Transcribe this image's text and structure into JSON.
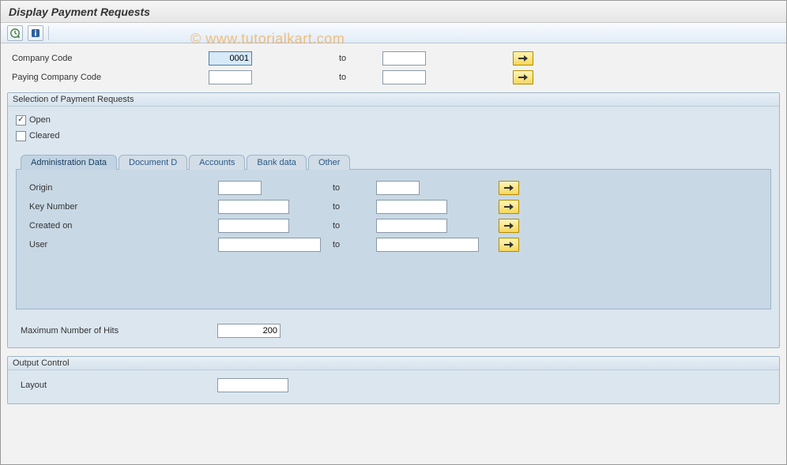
{
  "header": {
    "title": "Display Payment Requests"
  },
  "watermark": "© www.tutorialkart.com",
  "top_fields": {
    "company_code": {
      "label": "Company Code",
      "value": "0001",
      "to": "to",
      "to_value": ""
    },
    "paying_company_code": {
      "label": "Paying Company Code",
      "value": "",
      "to": "to",
      "to_value": ""
    }
  },
  "selection_group": {
    "title": "Selection of Payment Requests",
    "open": {
      "label": "Open",
      "checked": true
    },
    "cleared": {
      "label": "Cleared",
      "checked": false
    },
    "tabs": [
      "Administration Data",
      "Document D",
      "Accounts",
      "Bank data",
      "Other"
    ],
    "active_tab": 0,
    "admin_fields": {
      "origin": {
        "label": "Origin",
        "to": "to"
      },
      "key_number": {
        "label": "Key Number",
        "to": "to"
      },
      "created_on": {
        "label": "Created on",
        "to": "to"
      },
      "user": {
        "label": "User",
        "to": "to"
      }
    },
    "max_hits": {
      "label": "Maximum Number of Hits",
      "value": "200"
    }
  },
  "output_group": {
    "title": "Output Control",
    "layout": {
      "label": "Layout",
      "value": ""
    }
  }
}
